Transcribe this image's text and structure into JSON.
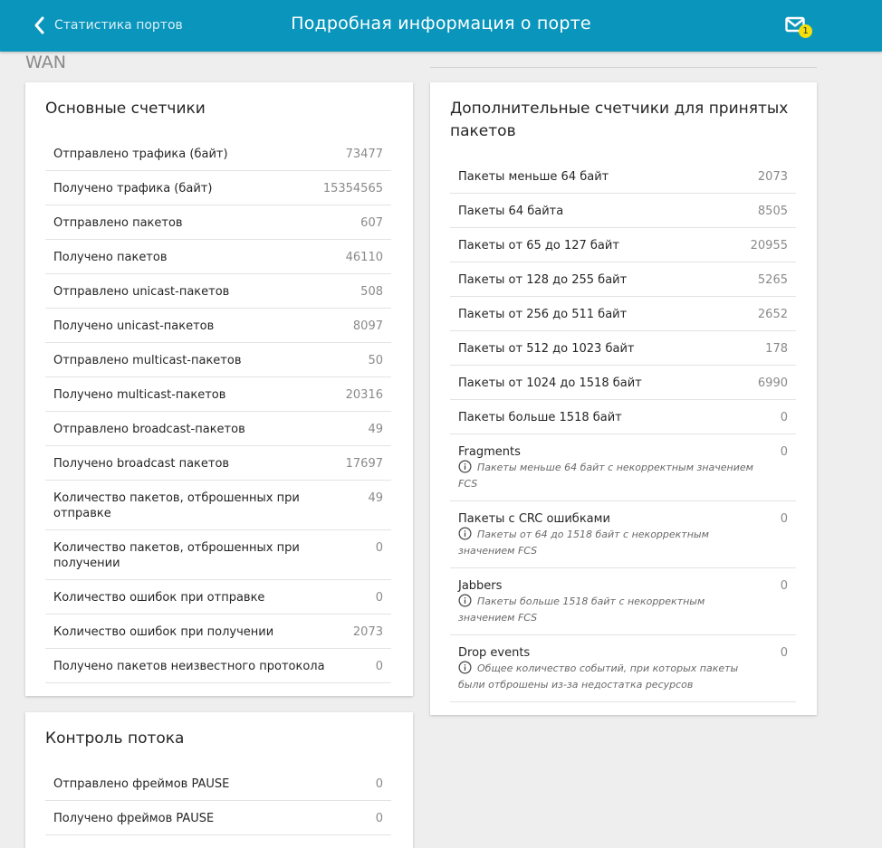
{
  "header": {
    "back_label": "Статистика портов",
    "title": "Подробная информация о порте",
    "notification_count": "1"
  },
  "section_label": "WAN",
  "main_counters": {
    "title": "Основные счетчики",
    "rows": [
      {
        "label": "Отправлено трафика (байт)",
        "value": "73477"
      },
      {
        "label": "Получено трафика (байт)",
        "value": "15354565"
      },
      {
        "label": "Отправлено пакетов",
        "value": "607"
      },
      {
        "label": "Получено пакетов",
        "value": "46110"
      },
      {
        "label": "Отправлено unicast-пакетов",
        "value": "508"
      },
      {
        "label": "Получено unicast-пакетов",
        "value": "8097"
      },
      {
        "label": "Отправлено multicast-пакетов",
        "value": "50"
      },
      {
        "label": "Получено multicast-пакетов",
        "value": "20316"
      },
      {
        "label": "Отправлено broadcast-пакетов",
        "value": "49"
      },
      {
        "label": "Получено broadcast пакетов",
        "value": "17697"
      },
      {
        "label1": "Количество пакетов, отброшенных при",
        "label2": "отправке",
        "value": "49"
      },
      {
        "label1": "Количество пакетов, отброшенных при",
        "label2": "получении",
        "value": "0"
      },
      {
        "label": "Количество ошибок при отправке",
        "value": "0"
      },
      {
        "label": "Количество ошибок при получении",
        "value": "2073"
      },
      {
        "label": "Получено пакетов неизвестного протокола",
        "value": "0"
      }
    ]
  },
  "extra_counters": {
    "title_line1": "Дополнительные счетчики для принятых",
    "title_line2": "пакетов",
    "rows": [
      {
        "label": "Пакеты меньше 64 байт",
        "value": "2073"
      },
      {
        "label": "Пакеты 64 байта",
        "value": "8505"
      },
      {
        "label": "Пакеты от 65 до 127 байт",
        "value": "20955"
      },
      {
        "label": "Пакеты от 128 до 255 байт",
        "value": "5265"
      },
      {
        "label": "Пакеты от 256 до 511 байт",
        "value": "2652"
      },
      {
        "label": "Пакеты от 512 до 1023 байт",
        "value": "178"
      },
      {
        "label": "Пакеты от 1024 до 1518 байт",
        "value": "6990"
      },
      {
        "label": "Пакеты больше 1518 байт",
        "value": "0"
      },
      {
        "label": "Fragments",
        "note1": "Пакеты меньше 64 байт с некорректным значением",
        "note2": "FCS",
        "value": "0"
      },
      {
        "label": "Пакеты с CRC ошибками",
        "note1": "Пакеты от 64 до 1518 байт с некорректным",
        "note2": "значением FCS",
        "value": "0"
      },
      {
        "label": "Jabbers",
        "note1": "Пакеты больше 1518 байт с некорректным",
        "note2": "значением FCS",
        "value": "0"
      },
      {
        "label": "Drop events",
        "note1": "Общее количество событий, при которых пакеты",
        "note2": "были отброшены из-за недостатка ресурсов",
        "value": "0"
      }
    ]
  },
  "flow_control": {
    "title": "Контроль потока",
    "rows": [
      {
        "label": "Отправлено фреймов PAUSE",
        "value": "0"
      },
      {
        "label": "Получено фреймов PAUSE",
        "value": "0"
      }
    ]
  },
  "colors": {
    "header_bg": "#0a96bc",
    "badge": "#f5e00a",
    "page_bg": "#eeeeee"
  },
  "icons": {
    "back": "chevron-left-icon",
    "notifications": "mail-icon",
    "note": "info-icon"
  }
}
